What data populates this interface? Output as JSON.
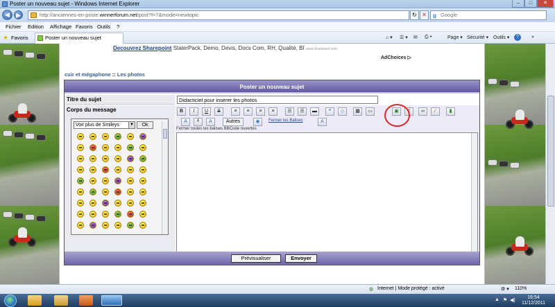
{
  "window": {
    "title": "Poster un nouveau sujet - Windows Internet Explorer"
  },
  "address": {
    "prefix": "http://anciennes-en-poste.",
    "domain": "winnerforum.net",
    "path": "/post?f=7&mode=newtopic"
  },
  "search": {
    "placeholder": "Google"
  },
  "menu": {
    "items": [
      "Fichier",
      "Edition",
      "Affichage",
      "Favoris",
      "Outils",
      "?"
    ]
  },
  "favbar": {
    "favorites_label": "Favoris",
    "tab_label": "Poster un nouveau sujet"
  },
  "toolbar": {
    "page": "Page ▾",
    "security": "Sécurité ▾",
    "tools": "Outils ▾",
    "help": "?"
  },
  "ad": {
    "link": "Decouvrez Sharepoint",
    "text": " StaterPack, Demo, Devis, Docs Com, RH, Qualité, BI",
    "small": "www.Avanteam.com",
    "choices": "AdChoices ▷"
  },
  "breadcrumb": {
    "forum": "cuir et mégaphone",
    "sep": " :: ",
    "section": "Les photos"
  },
  "form": {
    "header": "Poster un nouveau sujet",
    "subject_label": "Titre du sujet",
    "subject_value": "Didacticiel pour inserer les photos",
    "body_label": "Corps du message",
    "smiley_select": "Voir plus de Smileys",
    "smiley_ok": "Ok",
    "autres": "Autres",
    "fermer_balises": "Fermer les Balises",
    "close_all": "Fermer toutes les balises BBCode ouvertes",
    "preview_button": "Prévisualiser",
    "send_button": "Envoyer"
  },
  "format_buttons": [
    "B",
    "I",
    "U",
    "S"
  ],
  "status": {
    "zone": "Internet | Mode protégé : activé",
    "zoom": "110%"
  },
  "clock": {
    "time": "16:54",
    "date": "11/12/2011"
  },
  "colors": {
    "form_header": "#6b66a8",
    "red_circle": "#d8262a",
    "link": "#1d3f8a"
  }
}
